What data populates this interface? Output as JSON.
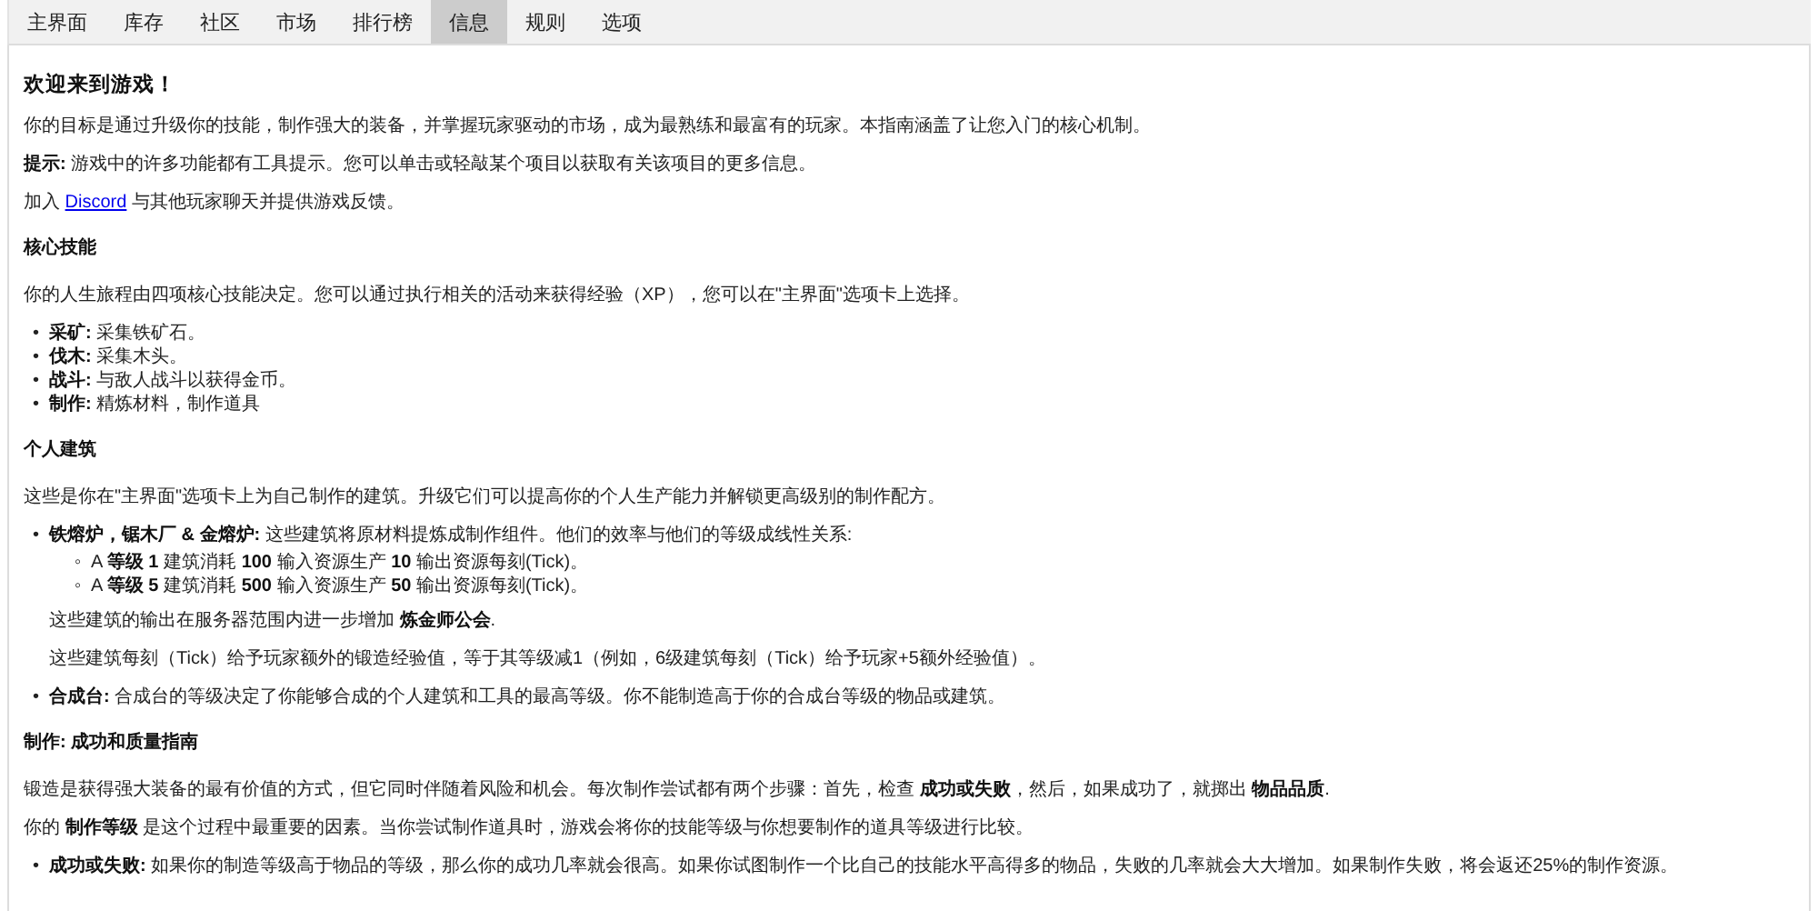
{
  "tabs": [
    {
      "label": "主界面",
      "selected": false
    },
    {
      "label": "库存",
      "selected": false
    },
    {
      "label": "社区",
      "selected": false
    },
    {
      "label": "市场",
      "selected": false
    },
    {
      "label": "排行榜",
      "selected": false
    },
    {
      "label": "信息",
      "selected": true
    },
    {
      "label": "规则",
      "selected": false
    },
    {
      "label": "选项",
      "selected": false
    }
  ],
  "blocks": [
    {
      "kind": "title",
      "text": "欢迎来到游戏！"
    },
    {
      "kind": "paragraph",
      "text": "你的目标是通过升级你的技能，制作强大的装备，并掌握玩家驱动的市场，成为最熟练和最富有的玩家。本指南涵盖了让您入门的核心机制。"
    },
    {
      "kind": "paragraph",
      "text": "**提示:** 游戏中的许多功能都有工具提示。您可以单击或轻敲某个项目以获取有关该项目的更多信息。"
    },
    {
      "kind": "link_paragraph",
      "before": "加入",
      "link": "Discord",
      "after": "与其他玩家聊天并提供游戏反馈。"
    },
    {
      "kind": "heading",
      "text": "核心技能"
    },
    {
      "kind": "paragraph",
      "text": "你的人生旅程由四项核心技能决定。您可以通过执行相关的活动来获得经验（XP），您可以在\"主界面\"选项卡上选择。"
    },
    {
      "kind": "list",
      "items": [
        {
          "bullet": "•",
          "text": "**采矿:** 采集铁矿石。"
        },
        {
          "bullet": "•",
          "text": "**伐木:** 采集木头。"
        },
        {
          "bullet": "•",
          "text": "**战斗:** 与敌人战斗以获得金币。"
        },
        {
          "bullet": "•",
          "text": "**制作:** 精炼材料，制作道具"
        }
      ]
    },
    {
      "kind": "heading",
      "text": "个人建筑"
    },
    {
      "kind": "paragraph",
      "text": "这些是你在\"主界面\"选项卡上为自己制作的建筑。升级它们可以提高你的个人生产能力并解锁更高级别的制作配方。"
    },
    {
      "kind": "list",
      "items": [
        {
          "bullet": "•",
          "text": "**铁熔炉，锯木厂 & 金熔炉:** 这些建筑将原材料提炼成制作组件。他们的效率与他们的等级成线性关系:",
          "children": [
            {
              "bullet": "◦",
              "text": "A **等级 1** 建筑消耗 **100** 输入资源生产 **10** 输出资源每刻(Tick)。"
            },
            {
              "bullet": "◦",
              "text": "A **等级 5** 建筑消耗 **500** 输入资源生产 **50** 输出资源每刻(Tick)。"
            }
          ],
          "notes": [
            "这些建筑的输出在服务器范围内进一步增加 **炼金师公会**.",
            "这些建筑每刻（Tick）给予玩家额外的锻造经验值，等于其等级减1（例如，6级建筑每刻（Tick）给予玩家+5额外经验值）。"
          ]
        },
        {
          "bullet": "•",
          "text": "**合成台:** 合成台的等级决定了你能够合成的个人建筑和工具的最高等级。你不能制造高于你的合成台等级的物品或建筑。"
        }
      ]
    },
    {
      "kind": "heading",
      "text": "制作: 成功和质量指南"
    },
    {
      "kind": "paragraph",
      "text": "锻造是获得强大装备的最有价值的方式，但它同时伴随着风险和机会。每次制作尝试都有两个步骤：首先，检查 **成功或失败**，然后，如果成功了，就掷出 **物品品质**."
    },
    {
      "kind": "paragraph",
      "text": "你的 **制作等级** 是这个过程中最重要的因素。当你尝试制作道具时，游戏会将你的技能等级与你想要制作的道具等级进行比较。"
    },
    {
      "kind": "list",
      "items": [
        {
          "bullet": "•",
          "text": "**成功或失败:** 如果你的制造等级高于物品的等级，那么你的成功几率就会很高。如果你试图制作一个比自己的技能水平高得多的物品，失败的几率就会大大增加。如果制作失败，将会返还25%的制作资源。"
        }
      ]
    }
  ]
}
